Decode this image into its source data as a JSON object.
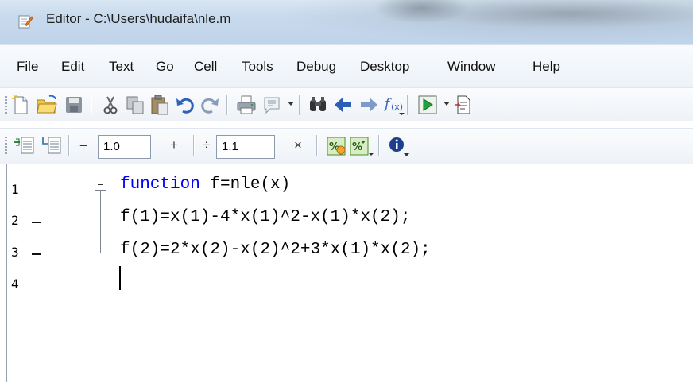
{
  "window": {
    "title": "Editor - C:\\Users\\hudaifa\\nle.m",
    "icon": "editor-document-icon"
  },
  "menu": {
    "items": [
      {
        "label": "File"
      },
      {
        "label": "Edit"
      },
      {
        "label": "Text"
      },
      {
        "label": "Go"
      },
      {
        "label": "Cell"
      },
      {
        "label": "Tools"
      },
      {
        "label": "Debug"
      },
      {
        "label": "Desktop"
      },
      {
        "label": "Window"
      },
      {
        "label": "Help"
      }
    ]
  },
  "toolbar": {
    "icons": [
      "new-file-icon",
      "open-folder-icon",
      "save-icon",
      "cut-icon",
      "copy-icon",
      "paste-icon",
      "undo-icon",
      "redo-icon",
      "print-icon",
      "comment-icon",
      "dropdown-icon",
      "find-icon",
      "back-icon",
      "forward-icon",
      "function-icon",
      "run-icon",
      "dropdown-icon",
      "publish-icon"
    ]
  },
  "cell_toolbar": {
    "minus_label": "−",
    "decrement_value": "1.0",
    "plus_label": "+",
    "divide_label": "÷",
    "factor_value": "1.1",
    "times_label": "×",
    "icons": [
      "insert-cell-divider-icon",
      "insert-cell-icon",
      "cell-eval-icon",
      "cell-eval-advance-icon",
      "cell-info-icon"
    ]
  },
  "editor": {
    "lines": [
      {
        "num": "1",
        "keyword": "function",
        "code": " f=nle(x)",
        "breakpoint_marker": false
      },
      {
        "num": "2",
        "keyword": "",
        "code": "f(1)=x(1)-4*x(1)^2-x(1)*x(2);",
        "breakpoint_marker": true
      },
      {
        "num": "3",
        "keyword": "",
        "code": "f(2)=2*x(2)-x(2)^2+3*x(1)*x(2);",
        "breakpoint_marker": true
      },
      {
        "num": "4",
        "keyword": "",
        "code": "",
        "breakpoint_marker": false
      }
    ],
    "keyword_color": "#0000ff"
  }
}
